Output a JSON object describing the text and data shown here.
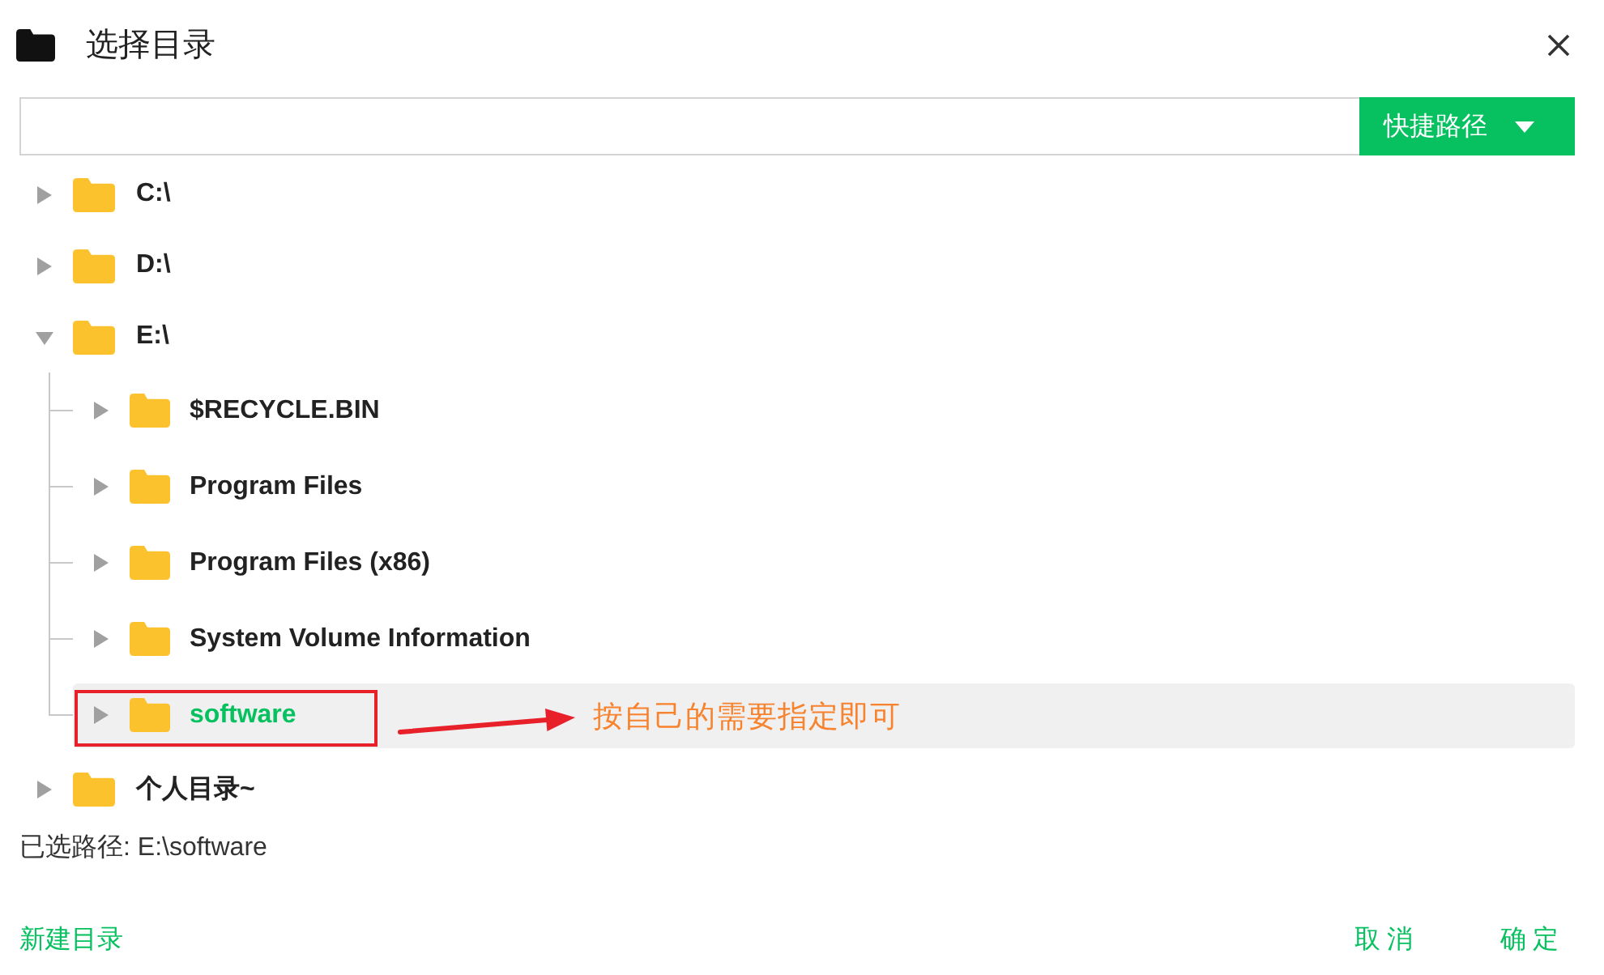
{
  "window": {
    "title": "选择目录"
  },
  "path_bar": {
    "shortcut_button": "快捷路径"
  },
  "tree": [
    {
      "label": "C:\\",
      "expanded": false,
      "selected": false
    },
    {
      "label": "D:\\",
      "expanded": false,
      "selected": false
    },
    {
      "label": "E:\\",
      "expanded": true,
      "selected": false,
      "children": [
        {
          "label": "$RECYCLE.BIN",
          "expanded": false,
          "selected": false
        },
        {
          "label": "Program Files",
          "expanded": false,
          "selected": false
        },
        {
          "label": "Program Files (x86)",
          "expanded": false,
          "selected": false
        },
        {
          "label": "System Volume Information",
          "expanded": false,
          "selected": false
        },
        {
          "label": "software",
          "expanded": false,
          "selected": true
        }
      ]
    },
    {
      "label": "个人目录~",
      "expanded": false,
      "selected": false
    }
  ],
  "annotation": {
    "text": "按自己的需要指定即可"
  },
  "selected_path": "已选路径: E:\\software",
  "footer": {
    "new_folder": "新建目录",
    "buttons": [
      "取消",
      "确定"
    ]
  }
}
